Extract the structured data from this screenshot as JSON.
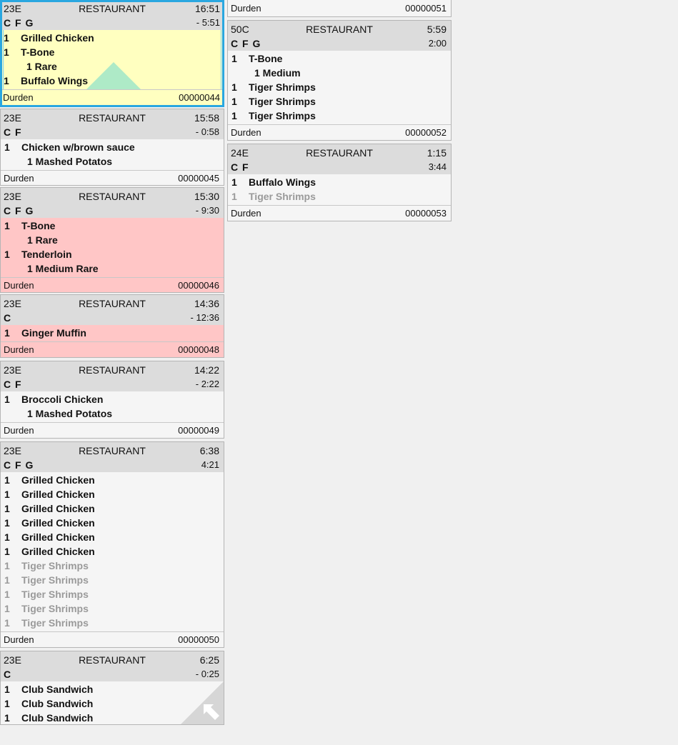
{
  "tickets_left": [
    {
      "seat": "23E",
      "place": "RESTAURANT",
      "time": "16:51",
      "flags": "C F G",
      "elapsed": "- 5:51",
      "items": [
        {
          "qty": "1",
          "name": "Grilled Chicken"
        },
        {
          "qty": "1",
          "name": "T-Bone"
        },
        {
          "qty": "",
          "name": "1 Rare",
          "mod": true
        },
        {
          "qty": "1",
          "name": "Buffalo Wings"
        }
      ],
      "server": "Durden",
      "number": "00000044"
    },
    {
      "seat": "23E",
      "place": "RESTAURANT",
      "time": "15:58",
      "flags": "C F",
      "elapsed": "- 0:58",
      "items": [
        {
          "qty": "1",
          "name": "Chicken w/brown sauce"
        },
        {
          "qty": "",
          "name": "1 Mashed Potatos",
          "mod": true
        }
      ],
      "server": "Durden",
      "number": "00000045"
    },
    {
      "seat": "23E",
      "place": "RESTAURANT",
      "time": "15:30",
      "flags": "C F G",
      "elapsed": "- 9:30",
      "items": [
        {
          "qty": "1",
          "name": "T-Bone"
        },
        {
          "qty": "",
          "name": "1 Rare",
          "mod": true
        },
        {
          "qty": "1",
          "name": "Tenderloin"
        },
        {
          "qty": "",
          "name": "1 Medium Rare",
          "mod": true
        }
      ],
      "server": "Durden",
      "number": "00000046"
    },
    {
      "seat": "23E",
      "place": "RESTAURANT",
      "time": "14:36",
      "flags": "C",
      "elapsed": "- 12:36",
      "items": [
        {
          "qty": "1",
          "name": "Ginger Muffin"
        }
      ],
      "server": "Durden",
      "number": "00000048"
    },
    {
      "seat": "23E",
      "place": "RESTAURANT",
      "time": "14:22",
      "flags": "C F",
      "elapsed": "- 2:22",
      "items": [
        {
          "qty": "1",
          "name": "Broccoli Chicken"
        },
        {
          "qty": "",
          "name": "1 Mashed Potatos",
          "mod": true
        }
      ],
      "server": "Durden",
      "number": "00000049"
    },
    {
      "seat": "23E",
      "place": "RESTAURANT",
      "time": "6:38",
      "flags": "C F G",
      "elapsed": "4:21",
      "items": [
        {
          "qty": "1",
          "name": "Grilled Chicken"
        },
        {
          "qty": "1",
          "name": "Grilled Chicken"
        },
        {
          "qty": "1",
          "name": "Grilled Chicken"
        },
        {
          "qty": "1",
          "name": "Grilled Chicken"
        },
        {
          "qty": "1",
          "name": "Grilled Chicken"
        },
        {
          "qty": "1",
          "name": "Grilled Chicken"
        },
        {
          "qty": "1",
          "name": "Tiger Shrimps",
          "dim": true
        },
        {
          "qty": "1",
          "name": "Tiger Shrimps",
          "dim": true
        },
        {
          "qty": "1",
          "name": "Tiger Shrimps",
          "dim": true
        },
        {
          "qty": "1",
          "name": "Tiger Shrimps",
          "dim": true
        },
        {
          "qty": "1",
          "name": "Tiger Shrimps",
          "dim": true
        }
      ],
      "server": "Durden",
      "number": "00000050"
    },
    {
      "seat": "23E",
      "place": "RESTAURANT",
      "time": "6:25",
      "flags": "C",
      "elapsed": "- 0:25",
      "items": [
        {
          "qty": "1",
          "name": "Club Sandwich"
        },
        {
          "qty": "1",
          "name": "Club Sandwich"
        },
        {
          "qty": "1",
          "name": "Club Sandwich"
        }
      ],
      "server": "",
      "number": ""
    }
  ],
  "tickets_right": [
    {
      "partial": true,
      "server": "Durden",
      "number": "00000051"
    },
    {
      "seat": "50C",
      "place": "RESTAURANT",
      "time": "5:59",
      "flags": "C F G",
      "elapsed": "2:00",
      "items": [
        {
          "qty": "1",
          "name": "T-Bone"
        },
        {
          "qty": "",
          "name": "1 Medium",
          "mod": true
        },
        {
          "qty": "1",
          "name": "Tiger Shrimps"
        },
        {
          "qty": "1",
          "name": "Tiger Shrimps"
        },
        {
          "qty": "1",
          "name": "Tiger Shrimps"
        }
      ],
      "server": "Durden",
      "number": "00000052"
    },
    {
      "seat": "24E",
      "place": "RESTAURANT",
      "time": "1:15",
      "flags": "C F",
      "elapsed": "3:44",
      "items": [
        {
          "qty": "1",
          "name": "Buffalo Wings"
        },
        {
          "qty": "1",
          "name": "Tiger Shrimps",
          "dim": true
        }
      ],
      "server": "Durden",
      "number": "00000053"
    }
  ],
  "colors": {
    "selected_border": "#2aa7e0",
    "yellow_bg": "#ffffc0",
    "overdue_bg": "#ffc6c6",
    "header_bg": "#dcdcdc",
    "dim_text": "#9a9a9a"
  }
}
